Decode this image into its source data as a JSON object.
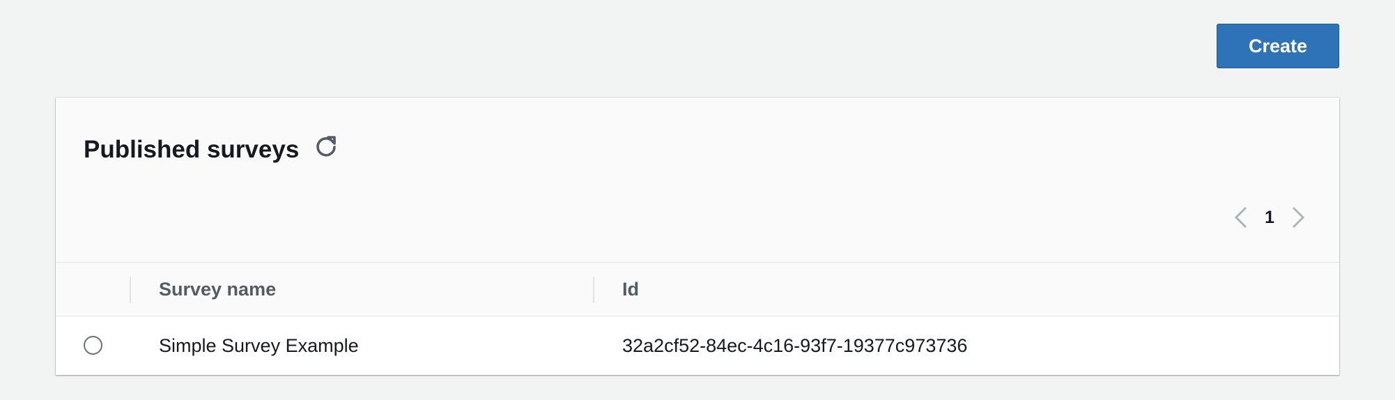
{
  "actions": {
    "create_label": "Create"
  },
  "panel": {
    "title": "Published surveys",
    "refresh_icon": "refresh-icon",
    "pagination": {
      "current_page": "1",
      "prev_icon": "chevron-left-icon",
      "next_icon": "chevron-right-icon"
    },
    "table": {
      "columns": [
        "Survey name",
        "Id"
      ],
      "rows": [
        {
          "selected": false,
          "name": "Simple Survey Example",
          "id": "32a2cf52-84ec-4c16-93f7-19377c973736"
        }
      ]
    }
  },
  "colors": {
    "page_background": "#f2f3f3",
    "primary_button": "#2e73b8",
    "panel_background": "#fafafa",
    "row_background": "#ffffff",
    "heading_text": "#16191f",
    "column_header_text": "#545b64",
    "disabled_arrow": "#aab7b8"
  }
}
